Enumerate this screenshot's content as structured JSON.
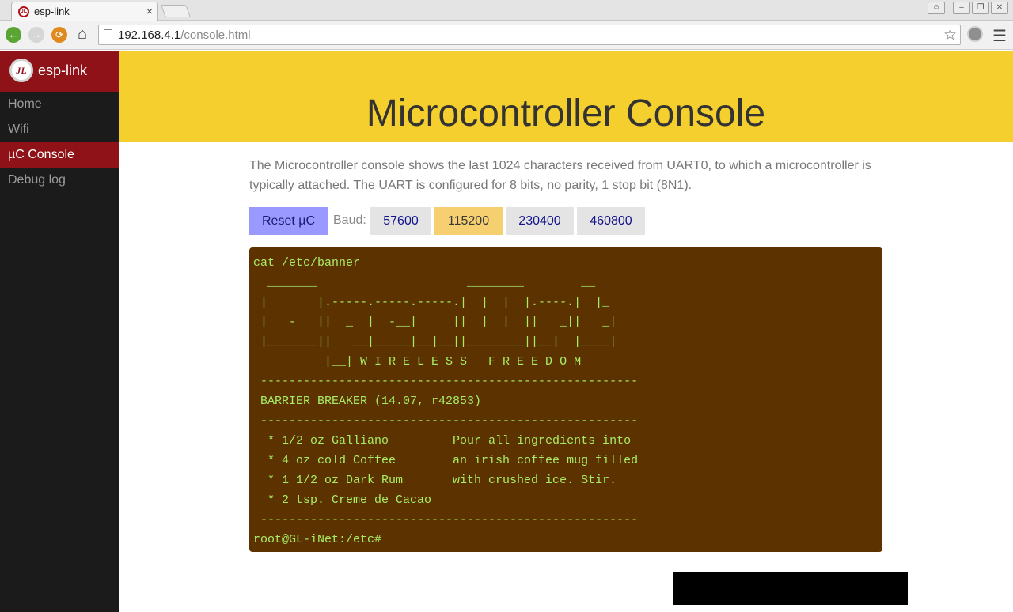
{
  "browser": {
    "tab_title": "esp-link",
    "tab_close": "×",
    "url_host": "192.168.4.1",
    "url_path": "/console.html"
  },
  "sidebar": {
    "brand": "esp-link",
    "items": [
      {
        "label": "Home",
        "active": false
      },
      {
        "label": "Wifi",
        "active": false
      },
      {
        "label": "µC Console",
        "active": true
      },
      {
        "label": "Debug log",
        "active": false
      }
    ]
  },
  "header": {
    "title": "Microcontroller Console"
  },
  "intro": "The Microcontroller console shows the last 1024 characters received from UART0, to which a microcontroller is typically attached. The UART is configured for 8 bits, no parity, 1 stop bit (8N1).",
  "controls": {
    "reset_label": "Reset µC",
    "baud_label": "Baud:",
    "baud_rates": [
      "57600",
      "115200",
      "230400",
      "460800"
    ],
    "selected_baud": "115200"
  },
  "console": {
    "lines": [
      "cat /etc/banner",
      "  _______                     ________        __",
      " |       |.-----.-----.-----.|  |  |  |.----.|  |_",
      " |   -   ||  _  |  -__|     ||  |  |  ||   _||   _|",
      " |_______||   __|_____|__|__||________||__|  |____|",
      "          |__| W I R E L E S S   F R E E D O M",
      " -----------------------------------------------------",
      " BARRIER BREAKER (14.07, r42853)",
      " -----------------------------------------------------",
      "  * 1/2 oz Galliano         Pour all ingredients into",
      "  * 4 oz cold Coffee        an irish coffee mug filled",
      "  * 1 1/2 oz Dark Rum       with crushed ice. Stir.",
      "  * 2 tsp. Creme de Cacao",
      " -----------------------------------------------------",
      "root@GL-iNet:/etc#"
    ]
  },
  "colors": {
    "brand_red": "#8e1217",
    "header_yellow": "#f5cf2d",
    "console_bg": "#5c3300",
    "console_text": "#a8ec64"
  }
}
